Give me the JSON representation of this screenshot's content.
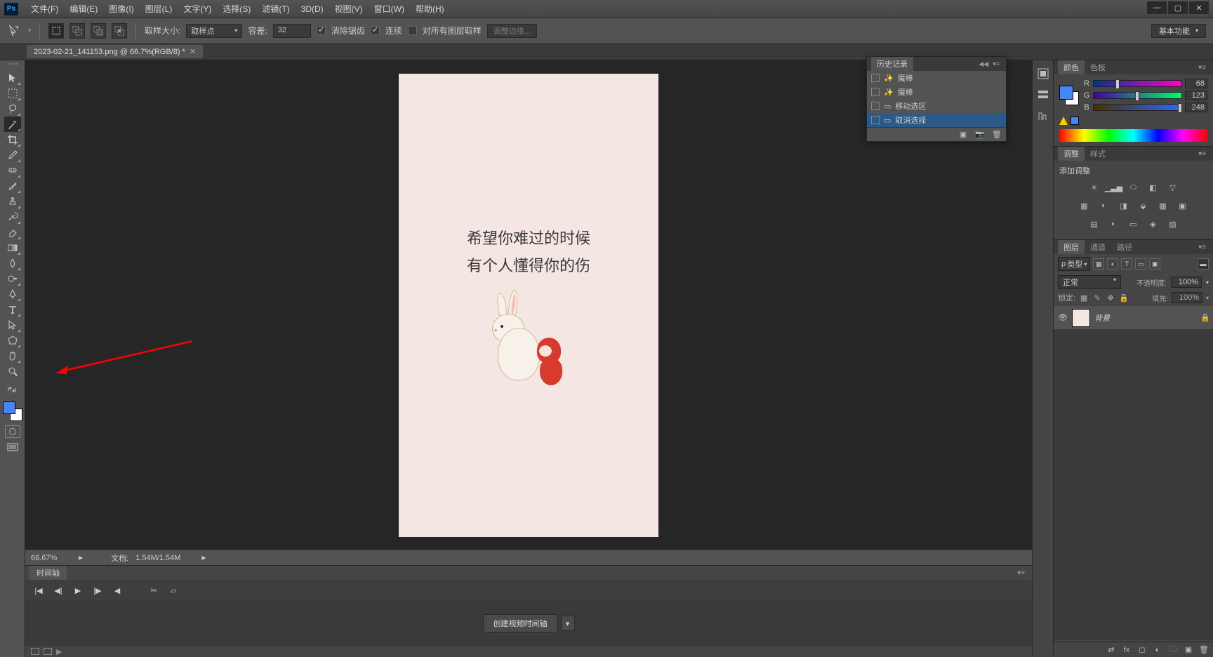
{
  "app": {
    "logo": "Ps"
  },
  "menubar": {
    "file": "文件(F)",
    "edit": "编辑(E)",
    "image": "图像(I)",
    "layer": "图层(L)",
    "type": "文字(Y)",
    "select": "选择(S)",
    "filter": "滤镜(T)",
    "threed": "3D(D)",
    "view": "视图(V)",
    "window": "窗口(W)",
    "help": "帮助(H)"
  },
  "options": {
    "sample_label": "取样大小:",
    "sample_value": "取样点",
    "tolerance_label": "容差:",
    "tolerance_value": "32",
    "antialias": "消除锯齿",
    "contiguous": "连续",
    "all_layers": "对所有图层取样",
    "refine": "调整边缘...",
    "workspace": "基本功能"
  },
  "document": {
    "tab_title": "2023-02-21_141153.png @ 66.7%(RGB/8) *"
  },
  "canvas": {
    "line1": "希望你难过的时候",
    "line2": "有个人懂得你的伤"
  },
  "status": {
    "zoom": "66.67%",
    "doc_label": "文档:",
    "doc_size": "1.54M/1.54M"
  },
  "timeline": {
    "tab": "时间轴",
    "create": "创建视频时间轴"
  },
  "history": {
    "title": "历史记录",
    "items": [
      {
        "label": "魔棒"
      },
      {
        "label": "魔棒"
      },
      {
        "label": "移动选区"
      },
      {
        "label": "取消选择"
      }
    ]
  },
  "color": {
    "tab_color": "颜色",
    "tab_swatch": "色板",
    "R_label": "R",
    "R_value": "68",
    "G_label": "G",
    "G_value": "123",
    "B_label": "B",
    "B_value": "248"
  },
  "adjustments": {
    "tab_adj": "调整",
    "tab_style": "样式",
    "title": "添加调整"
  },
  "layers": {
    "tab_layers": "图层",
    "tab_channels": "通道",
    "tab_paths": "路径",
    "filter_label": "类型",
    "blend_mode": "正常",
    "opacity_label": "不透明度:",
    "opacity_value": "100%",
    "lock_label": "锁定:",
    "fill_label": "填充:",
    "fill_value": "100%",
    "layer1_name": "背景"
  }
}
